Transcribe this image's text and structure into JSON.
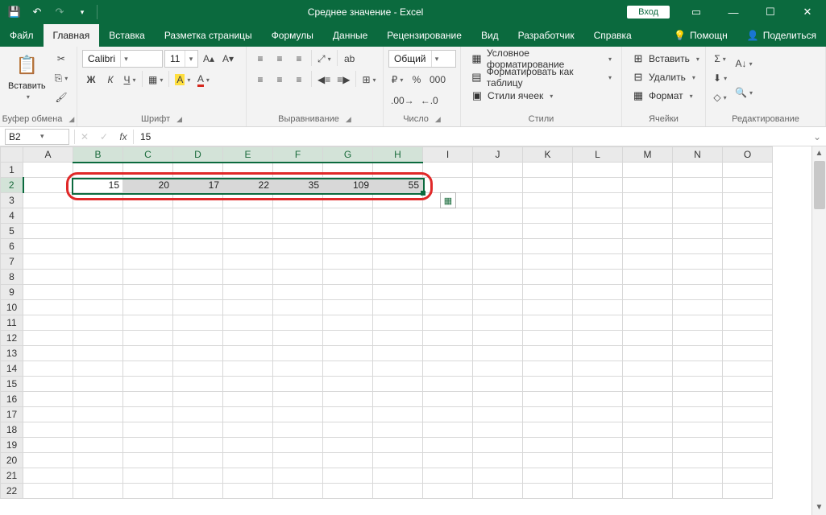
{
  "title": "Среднее значение  -  Excel",
  "login": "Вход",
  "tabs": {
    "file": "Файл",
    "home": "Главная",
    "insert": "Вставка",
    "pagelayout": "Разметка страницы",
    "formulas": "Формулы",
    "data": "Данные",
    "review": "Рецензирование",
    "view": "Вид",
    "developer": "Разработчик",
    "help": "Справка",
    "tellme": "Помощн",
    "share": "Поделиться"
  },
  "ribbon": {
    "clipboard": {
      "label": "Буфер обмена",
      "paste": "Вставить"
    },
    "font": {
      "label": "Шрифт",
      "family": "Calibri",
      "size": "11",
      "bold": "Ж",
      "italic": "К",
      "underline": "Ч"
    },
    "alignment": {
      "label": "Выравнивание"
    },
    "number": {
      "label": "Число",
      "format": "Общий"
    },
    "styles": {
      "label": "Стили",
      "conditional": "Условное форматирование",
      "table": "Форматировать как таблицу",
      "cell": "Стили ячеек"
    },
    "cells": {
      "label": "Ячейки",
      "insert": "Вставить",
      "delete": "Удалить",
      "format": "Формат"
    },
    "editing": {
      "label": "Редактирование"
    }
  },
  "namebox": "B2",
  "formula": "15",
  "columns": [
    "A",
    "B",
    "C",
    "D",
    "E",
    "F",
    "G",
    "H",
    "I",
    "J",
    "K",
    "L",
    "M",
    "N",
    "O"
  ],
  "rows": 22,
  "data_row": {
    "B": "15",
    "C": "20",
    "D": "17",
    "E": "22",
    "F": "35",
    "G": "109",
    "H": "55"
  },
  "selection": {
    "active": "B2",
    "from": "B2",
    "to": "H2"
  }
}
